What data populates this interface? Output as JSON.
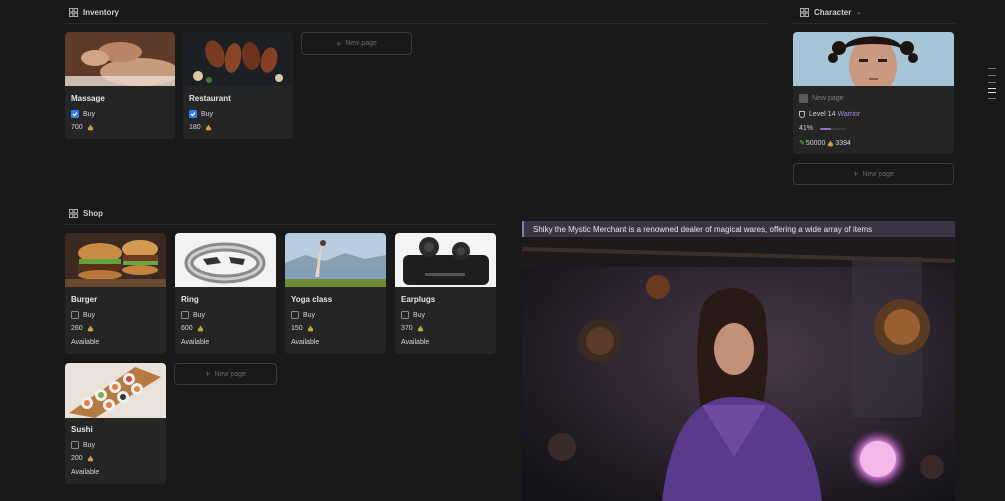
{
  "inventory": {
    "title": "Inventory",
    "items": [
      {
        "title": "Massage",
        "buy_label": "Buy",
        "checked": true,
        "price": "700"
      },
      {
        "title": "Restaurant",
        "buy_label": "Buy",
        "checked": true,
        "price": "180"
      }
    ],
    "new_page": "New page"
  },
  "character": {
    "title": "Character",
    "new_page_row": "New page",
    "level_text": "Level 14",
    "class_text": "Warrior",
    "progress_text": "41%",
    "progress_value": 0.41,
    "stat_a": "50000",
    "stat_b": "3394",
    "new_page": "New page"
  },
  "shop": {
    "title": "Shop",
    "items": [
      {
        "title": "Burger",
        "buy_label": "Buy",
        "price": "260",
        "status": "Available"
      },
      {
        "title": "Ring",
        "buy_label": "Buy",
        "price": "600",
        "status": "Available"
      },
      {
        "title": "Yoga class",
        "buy_label": "Buy",
        "price": "150",
        "status": "Available"
      },
      {
        "title": "Earplugs",
        "buy_label": "Buy",
        "price": "370",
        "status": "Available"
      },
      {
        "title": "Sushi",
        "buy_label": "Buy",
        "price": "200",
        "status": "Available"
      }
    ],
    "new_page": "New page"
  },
  "merchant": {
    "caption": "Shiky the Mystic Merchant is a renowned dealer of magical wares, offering a wide array of items"
  },
  "colors": {
    "background": "#191919",
    "card": "#252525",
    "checkbox_checked": "#2f80ed",
    "class_accent": "#a98be0",
    "progress": "#8f6fd8"
  }
}
